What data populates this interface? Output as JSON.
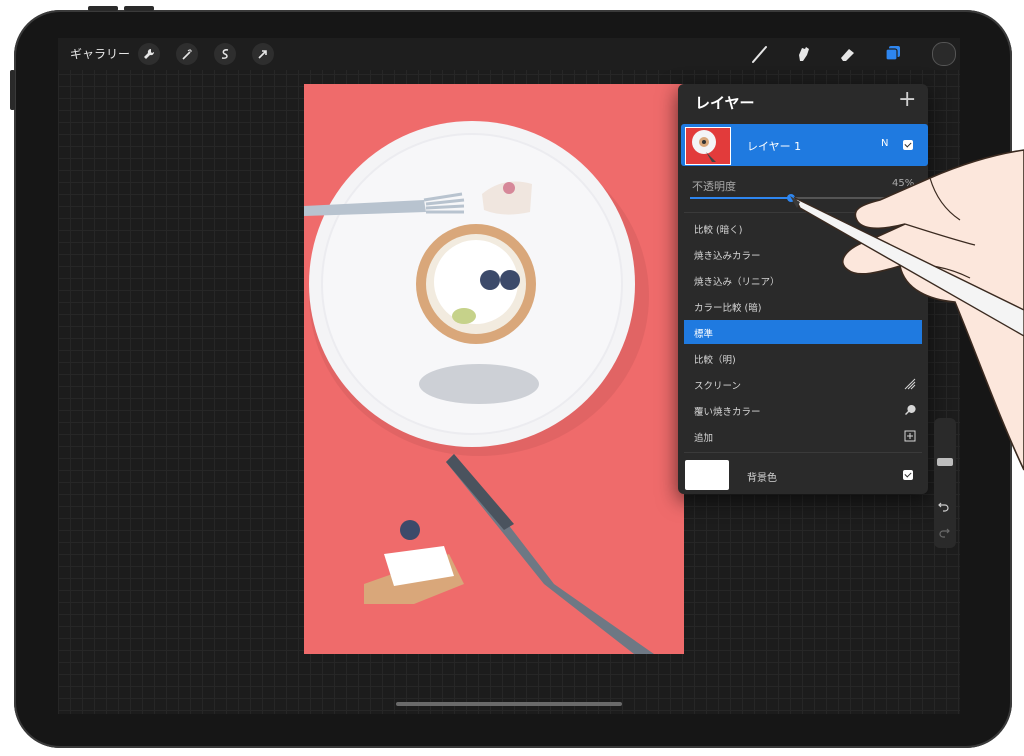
{
  "topbar": {
    "gallery_label": "ギャラリー",
    "left_tools": [
      "wrench-icon",
      "magic-wand-icon",
      "selection-icon",
      "transform-arrow-icon"
    ],
    "right_tools": [
      "brush-icon",
      "smudge-icon",
      "eraser-icon",
      "layers-icon"
    ],
    "active_color": "#2a2a2a"
  },
  "layers_panel": {
    "title": "レイヤー",
    "add_label": "+",
    "layer": {
      "name": "レイヤー 1",
      "mode": "N",
      "visible": true
    },
    "opacity": {
      "label": "不透明度",
      "value_text": "45%",
      "value": 0.45
    },
    "blend_modes": [
      {
        "label": "比較 (暗く)",
        "icon": "",
        "selected": false
      },
      {
        "label": "焼き込みカラー",
        "icon": "",
        "selected": false
      },
      {
        "label": "焼き込み（リニア）",
        "icon": "",
        "selected": false
      },
      {
        "label": "カラー比較 (暗)",
        "icon": "",
        "selected": false
      },
      {
        "label": "標準",
        "icon": "",
        "selected": true
      },
      {
        "label": "比較（明)",
        "icon": "",
        "selected": false
      },
      {
        "label": "スクリーン",
        "icon": "screen-icon",
        "selected": false
      },
      {
        "label": "覆い焼きカラー",
        "icon": "dodge-icon",
        "selected": false
      },
      {
        "label": "追加",
        "icon": "add-icon",
        "selected": false
      }
    ],
    "background": {
      "label": "背景色",
      "visible": true
    }
  },
  "colors": {
    "accent": "#1f7ae0",
    "canvas": "#ef6b6b"
  }
}
